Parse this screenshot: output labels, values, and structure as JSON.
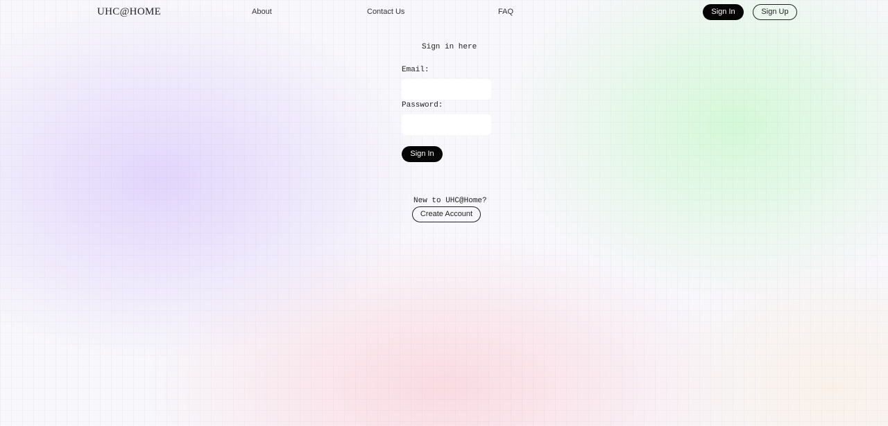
{
  "header": {
    "logo": "UHC@HOME",
    "nav": {
      "about": "About",
      "contact": "Contact Us",
      "faq": "FAQ"
    },
    "signin_label": "Sign In",
    "signup_label": "Sign Up"
  },
  "form": {
    "title": "Sign in here",
    "email_label": "Email:",
    "email_value": "",
    "password_label": "Password:",
    "password_value": "",
    "submit_label": "Sign In"
  },
  "signup_prompt": {
    "text": "New to UHC@Home?",
    "button_label": "Create Account"
  },
  "colors": {
    "primary_button": "#050505",
    "background": "#f8f7fb",
    "accent_purple": "#ded0fc",
    "accent_green": "#cef8d2",
    "accent_pink": "#fbd6de"
  }
}
